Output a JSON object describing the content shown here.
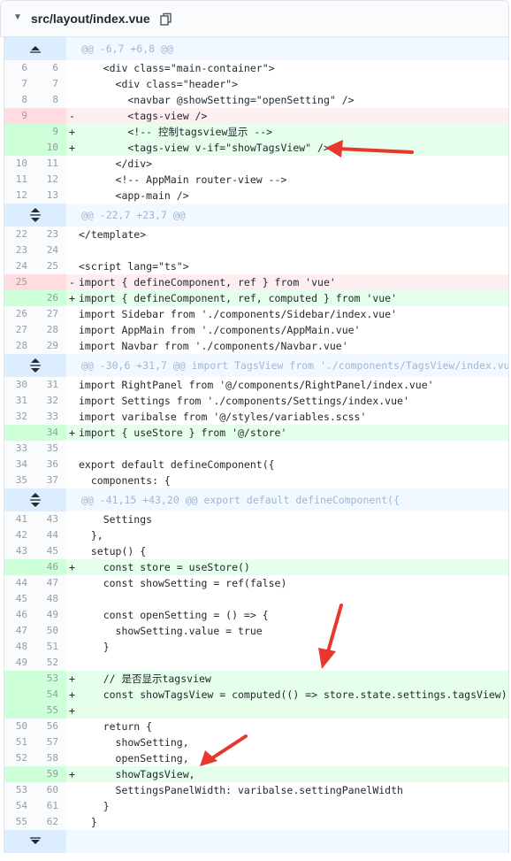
{
  "file": {
    "path": "src/layout/index.vue"
  },
  "hunks": [
    "@@ -6,7 +6,8 @@",
    "@@ -22,7 +23,7 @@",
    "@@ -30,6 +31,7 @@ import TagsView from './components/TagsView/index.vue'",
    "@@ -41,15 +43,20 @@ export default defineComponent({"
  ],
  "lines": [
    {
      "old": "6",
      "new": "6",
      "type": "ctx",
      "text": "    <div class=\"main-container\">"
    },
    {
      "old": "7",
      "new": "7",
      "type": "ctx",
      "text": "      <div class=\"header\">"
    },
    {
      "old": "8",
      "new": "8",
      "type": "ctx",
      "text": "        <navbar @showSetting=\"openSetting\" />"
    },
    {
      "old": "9",
      "new": "",
      "type": "del",
      "sign": "-",
      "text": "        <tags-view />"
    },
    {
      "old": "",
      "new": "9",
      "type": "add",
      "sign": "+",
      "text": "        <!-- 控制tagsview显示 -->"
    },
    {
      "old": "",
      "new": "10",
      "type": "add",
      "sign": "+",
      "text": "        <tags-view v-if=\"showTagsView\" />"
    },
    {
      "old": "10",
      "new": "11",
      "type": "ctx",
      "text": "      </div>"
    },
    {
      "old": "11",
      "new": "12",
      "type": "ctx",
      "text": "      <!-- AppMain router-view -->"
    },
    {
      "old": "12",
      "new": "13",
      "type": "ctx",
      "text": "      <app-main />"
    },
    {
      "old": "22",
      "new": "23",
      "type": "ctx",
      "text": "</template>"
    },
    {
      "old": "23",
      "new": "24",
      "type": "ctx",
      "text": ""
    },
    {
      "old": "24",
      "new": "25",
      "type": "ctx",
      "text": "<script lang=\"ts\">"
    },
    {
      "old": "25",
      "new": "",
      "type": "del",
      "sign": "-",
      "text": "import { defineComponent, ref } from 'vue'"
    },
    {
      "old": "",
      "new": "26",
      "type": "add",
      "sign": "+",
      "text": "import { defineComponent, ref, computed } from 'vue'"
    },
    {
      "old": "26",
      "new": "27",
      "type": "ctx",
      "text": "import Sidebar from './components/Sidebar/index.vue'"
    },
    {
      "old": "27",
      "new": "28",
      "type": "ctx",
      "text": "import AppMain from './components/AppMain.vue'"
    },
    {
      "old": "28",
      "new": "29",
      "type": "ctx",
      "text": "import Navbar from './components/Navbar.vue'"
    },
    {
      "old": "30",
      "new": "31",
      "type": "ctx",
      "text": "import RightPanel from '@/components/RightPanel/index.vue'"
    },
    {
      "old": "31",
      "new": "32",
      "type": "ctx",
      "text": "import Settings from './components/Settings/index.vue'"
    },
    {
      "old": "32",
      "new": "33",
      "type": "ctx",
      "text": "import varibalse from '@/styles/variables.scss'"
    },
    {
      "old": "",
      "new": "34",
      "type": "add",
      "sign": "+",
      "text": "import { useStore } from '@/store'"
    },
    {
      "old": "33",
      "new": "35",
      "type": "ctx",
      "text": ""
    },
    {
      "old": "34",
      "new": "36",
      "type": "ctx",
      "text": "export default defineComponent({"
    },
    {
      "old": "35",
      "new": "37",
      "type": "ctx",
      "text": "  components: {"
    },
    {
      "old": "41",
      "new": "43",
      "type": "ctx",
      "text": "    Settings"
    },
    {
      "old": "42",
      "new": "44",
      "type": "ctx",
      "text": "  },"
    },
    {
      "old": "43",
      "new": "45",
      "type": "ctx",
      "text": "  setup() {"
    },
    {
      "old": "",
      "new": "46",
      "type": "add",
      "sign": "+",
      "text": "    const store = useStore()"
    },
    {
      "old": "44",
      "new": "47",
      "type": "ctx",
      "text": "    const showSetting = ref(false)"
    },
    {
      "old": "45",
      "new": "48",
      "type": "ctx",
      "text": ""
    },
    {
      "old": "46",
      "new": "49",
      "type": "ctx",
      "text": "    const openSetting = () => {"
    },
    {
      "old": "47",
      "new": "50",
      "type": "ctx",
      "text": "      showSetting.value = true"
    },
    {
      "old": "48",
      "new": "51",
      "type": "ctx",
      "text": "    }"
    },
    {
      "old": "49",
      "new": "52",
      "type": "ctx",
      "text": ""
    },
    {
      "old": "",
      "new": "53",
      "type": "add",
      "sign": "+",
      "text": "    // 是否显示tagsview"
    },
    {
      "old": "",
      "new": "54",
      "type": "add",
      "sign": "+",
      "text": "    const showTagsView = computed(() => store.state.settings.tagsView)"
    },
    {
      "old": "",
      "new": "55",
      "type": "add",
      "sign": "+",
      "text": ""
    },
    {
      "old": "50",
      "new": "56",
      "type": "ctx",
      "text": "    return {"
    },
    {
      "old": "51",
      "new": "57",
      "type": "ctx",
      "text": "      showSetting,"
    },
    {
      "old": "52",
      "new": "58",
      "type": "ctx",
      "text": "      openSetting,"
    },
    {
      "old": "",
      "new": "59",
      "type": "add",
      "sign": "+",
      "text": "      showTagsView,"
    },
    {
      "old": "53",
      "new": "60",
      "type": "ctx",
      "text": "      SettingsPanelWidth: varibalse.settingPanelWidth"
    },
    {
      "old": "54",
      "new": "61",
      "type": "ctx",
      "text": "    }"
    },
    {
      "old": "55",
      "new": "62",
      "type": "ctx",
      "text": "  }"
    }
  ],
  "colors": {
    "added_bg": "#e6ffed",
    "added_num_bg": "#cdffd8",
    "deleted_bg": "#ffeef0",
    "deleted_num_bg": "#ffdce0",
    "hunk_bg": "#f1f8ff",
    "annotation_arrow": "#e8382e"
  }
}
